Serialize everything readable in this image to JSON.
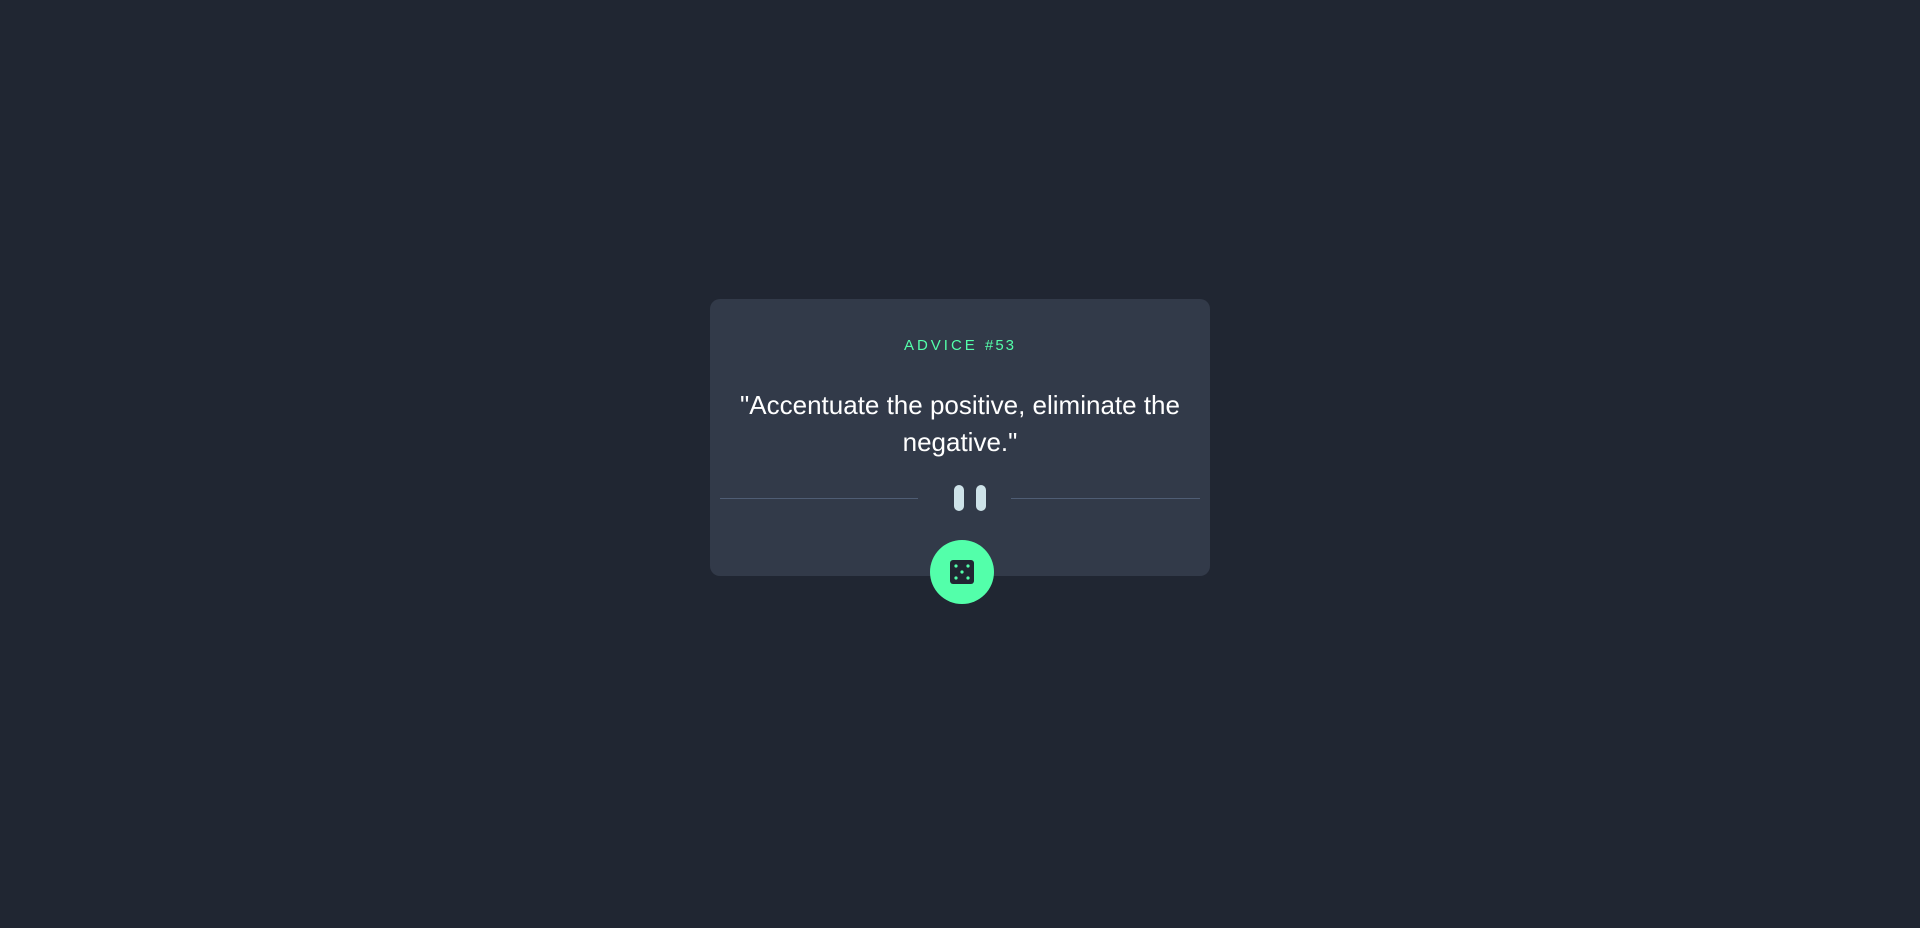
{
  "advice": {
    "label": "ADVICE",
    "number": "#53",
    "quote": "\"Accentuate the positive, eliminate the negative.\""
  },
  "divider": {
    "icon": "pause-icon"
  },
  "button": {
    "icon": "dice-icon"
  },
  "colors": {
    "background": "#202632",
    "card": "#323a49",
    "accent": "#53ffaa",
    "divider": "#4f5d74",
    "text": "#ffffff",
    "pause": "#cee3e9"
  }
}
